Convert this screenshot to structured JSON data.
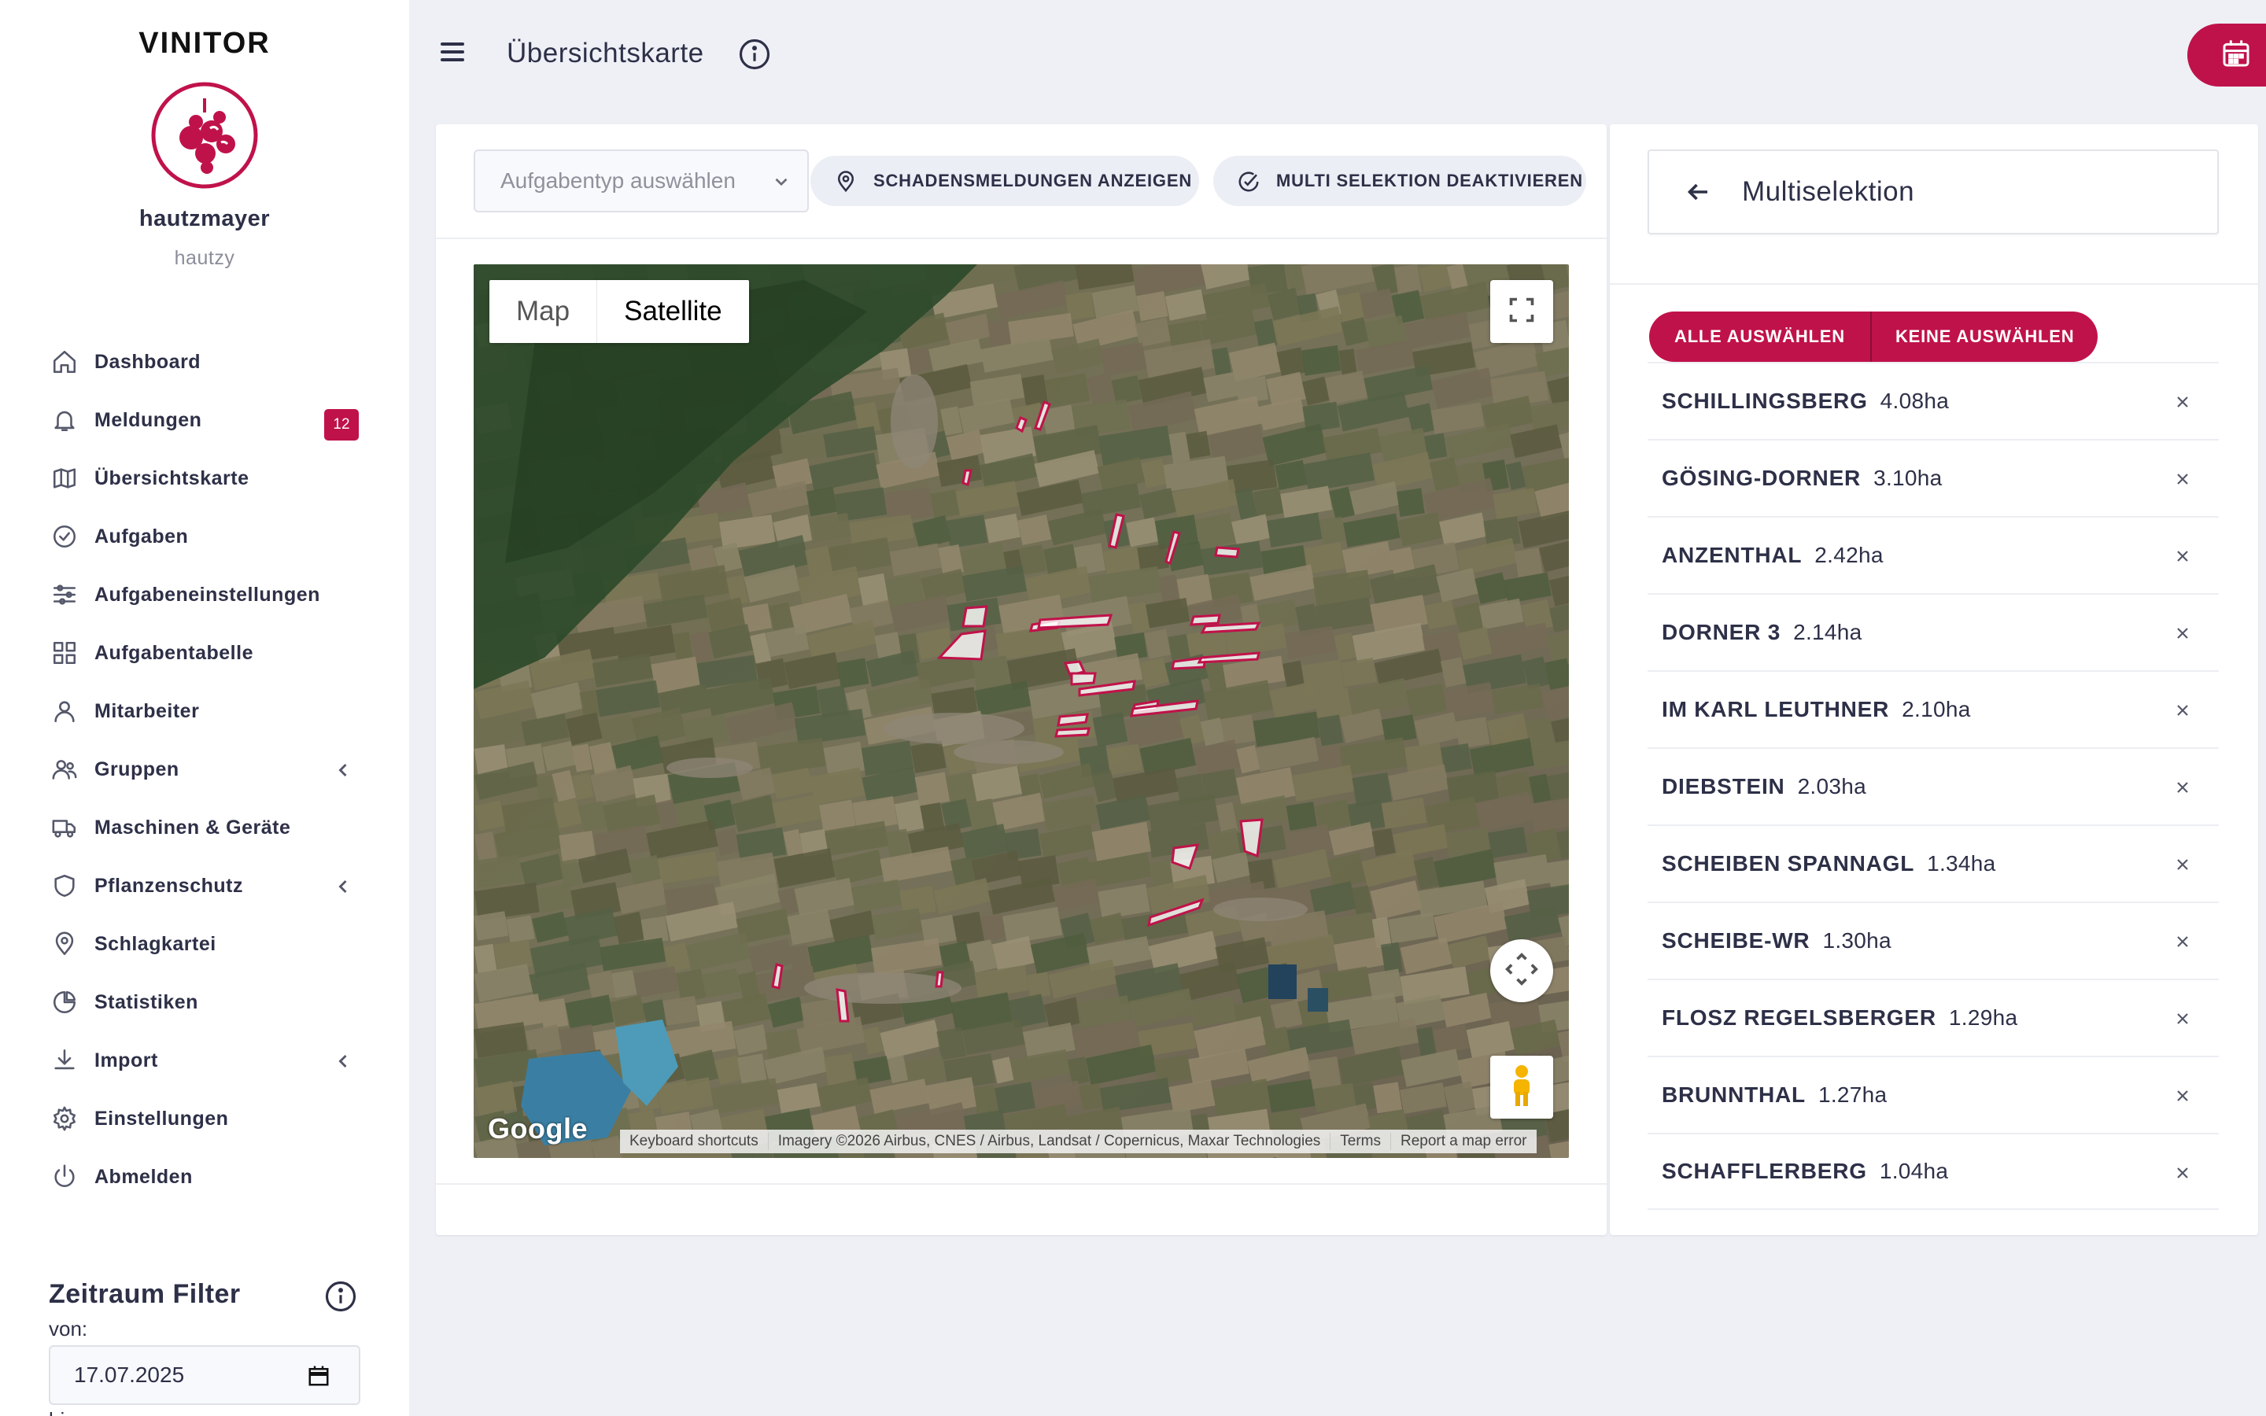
{
  "app": {
    "brand": "VINITOR",
    "username": "hautzmayer",
    "userhandle": "hautzy",
    "accent_color": "#c0124a"
  },
  "sidebar": {
    "items": [
      {
        "label": "Dashboard",
        "icon": "home-icon"
      },
      {
        "label": "Meldungen",
        "icon": "bell-icon",
        "badge": "12"
      },
      {
        "label": "Übersichtskarte",
        "icon": "map-icon"
      },
      {
        "label": "Aufgaben",
        "icon": "check-circle-icon"
      },
      {
        "label": "Aufgabeneinstellungen",
        "icon": "sliders-icon"
      },
      {
        "label": "Aufgabentabelle",
        "icon": "grid-icon"
      },
      {
        "label": "Mitarbeiter",
        "icon": "user-icon"
      },
      {
        "label": "Gruppen",
        "icon": "users-icon",
        "expandable": true
      },
      {
        "label": "Maschinen & Geräte",
        "icon": "truck-icon"
      },
      {
        "label": "Pflanzenschutz",
        "icon": "shield-icon",
        "expandable": true
      },
      {
        "label": "Schlagkartei",
        "icon": "map-pin-icon"
      },
      {
        "label": "Statistiken",
        "icon": "pie-chart-icon"
      },
      {
        "label": "Import",
        "icon": "download-icon",
        "expandable": true
      },
      {
        "label": "Einstellungen",
        "icon": "gear-icon"
      },
      {
        "label": "Abmelden",
        "icon": "power-icon"
      }
    ]
  },
  "zeitraum": {
    "title": "Zeitraum Filter",
    "von_label": "von:",
    "von_value": "17.07.2025",
    "bis_label": "bis:"
  },
  "header": {
    "title": "Übersichtskarte"
  },
  "map_toolbar": {
    "select_placeholder": "Aufgabentyp auswählen",
    "damage_button": "SCHADENSMELDUNGEN ANZEIGEN",
    "multi_button": "MULTI SELEKTION DEAKTIVIEREN"
  },
  "map": {
    "type_map": "Map",
    "type_satellite": "Satellite",
    "selected_type": "Satellite",
    "google": "Google",
    "attribution": {
      "shortcuts": "Keyboard shortcuts",
      "imagery": "Imagery ©2026 Airbus, CNES / Airbus, Landsat / Copernicus, Maxar Technologies",
      "terms": "Terms",
      "report": "Report a map error"
    }
  },
  "multiselect": {
    "title": "Multiselektion",
    "select_all": "ALLE AUSWÄHLEN",
    "select_none": "KEINE AUSWÄHLEN",
    "fields": [
      {
        "name": "SCHILLINGSBERG",
        "area": "4.08ha"
      },
      {
        "name": "GÖSING-DORNER",
        "area": "3.10ha"
      },
      {
        "name": "ANZENTHAL",
        "area": "2.42ha"
      },
      {
        "name": "DORNER 3",
        "area": "2.14ha"
      },
      {
        "name": "IM KARL LEUTHNER",
        "area": "2.10ha"
      },
      {
        "name": "DIEBSTEIN",
        "area": "2.03ha"
      },
      {
        "name": "SCHEIBEN SPANNAGL",
        "area": "1.34ha"
      },
      {
        "name": "SCHEIBE-WR",
        "area": "1.30ha"
      },
      {
        "name": "FLOSZ REGELSBERGER",
        "area": "1.29ha"
      },
      {
        "name": "BRUNNTHAL",
        "area": "1.27ha"
      },
      {
        "name": "SCHAFFLERBERG",
        "area": "1.04ha"
      }
    ]
  }
}
